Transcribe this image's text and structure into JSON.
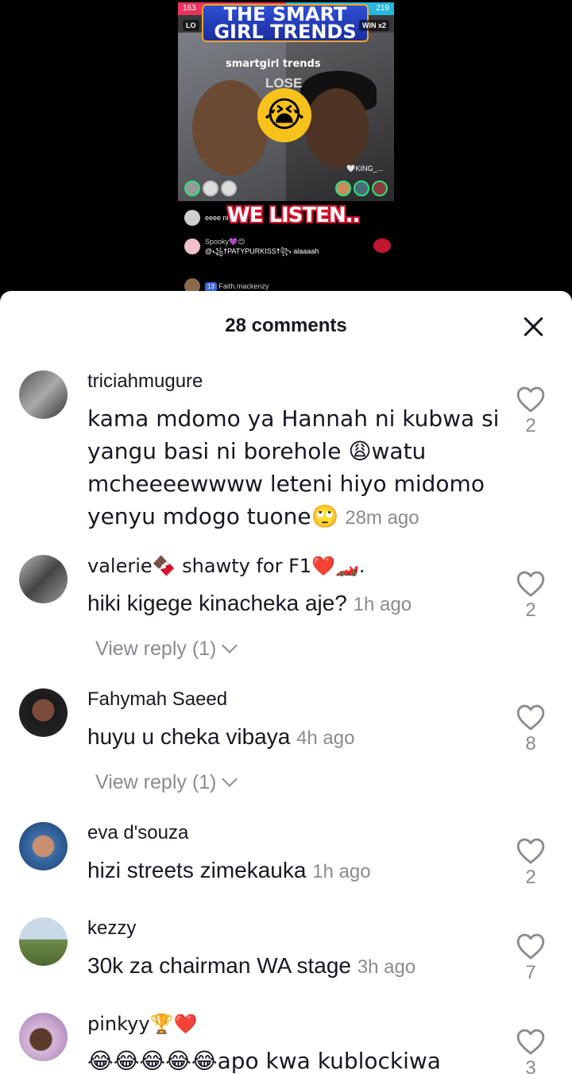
{
  "live": {
    "score_left": "163",
    "score_right": "219",
    "title": "THE SMART GIRL TRENDS",
    "tag_left": "LO",
    "tag_right": "WIN x2",
    "brand": "smartgirl trends",
    "lose": "LOSE",
    "emoji": "😭",
    "king": "🤍KING_...",
    "overlay_text": "WE LISTEN..",
    "chat": [
      {
        "badge": "",
        "nick": "",
        "text": "eeee ni"
      },
      {
        "badge": "",
        "nick": "Spooky💜😊",
        "text": "@꧁☨PATYPURKISS☨꧂ alaaaah"
      },
      {
        "badge": "13",
        "nick": "Faith.mackenzy",
        "text": ""
      }
    ]
  },
  "sheet": {
    "title": "28 comments",
    "close_label": "Close"
  },
  "comments": [
    {
      "user": "triciahmugure",
      "text": "kama mdomo ya Hannah ni kubwa si yangu basi ni borehole 😩watu mcheeeewwww leteni hiyo midomo yenyu mdogo tuone🙄",
      "time": "28m ago",
      "likes": "2",
      "reply": ""
    },
    {
      "user": "valerie🍫 shawty for F1❤️🏎️.",
      "text": "hiki kigege kinacheka aje?",
      "time": "1h ago",
      "likes": "2",
      "reply": "View reply (1)"
    },
    {
      "user": "Fahymah Saeed",
      "text": "huyu u cheka vibaya",
      "time": "4h ago",
      "likes": "8",
      "reply": "View reply (1)"
    },
    {
      "user": "eva d'souza",
      "text": "hizi streets zimekauka",
      "time": "1h ago",
      "likes": "2",
      "reply": ""
    },
    {
      "user": "kezzy",
      "text": "30k za chairman WA stage",
      "time": "3h ago",
      "likes": "7",
      "reply": ""
    },
    {
      "user": "pinkyy🏆❤️",
      "text": "😂😂😂😂😂apo kwa kublockiwa",
      "time": "",
      "likes": "3",
      "reply": ""
    }
  ],
  "colors": {
    "text_primary": "#161823",
    "text_secondary": "#8a8b91",
    "sheet_bg": "#ffffff",
    "video_bg": "#000000"
  },
  "icons": {
    "like": "heart-outline-icon",
    "close": "close-icon",
    "expand": "chevron-down-icon"
  }
}
